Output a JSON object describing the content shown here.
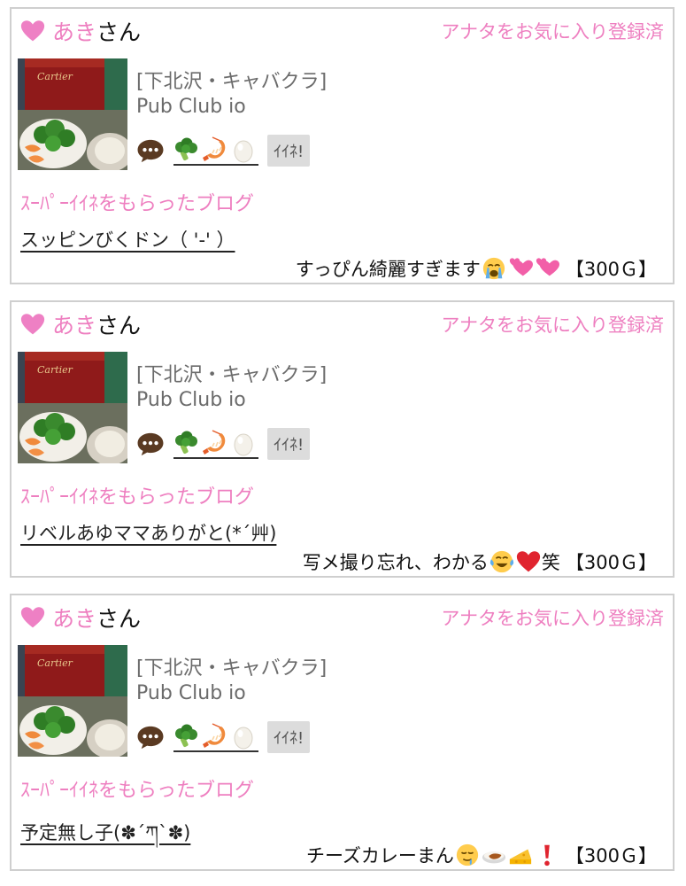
{
  "posts": [
    {
      "user_name": "あき",
      "honorific": "さん",
      "favorite_status": "アナタをお気に入り登録済",
      "shop_category": "[下北沢・キャバクラ]",
      "shop_name": "Pub Club io",
      "iine_label": "ｲｲﾈ!",
      "super_iine_label": "ｽｰﾊﾟｰｲｲﾈをもらったブログ",
      "blog_title": "スッピンびくドン（ '-' ）",
      "comment_text": "すっぴん綺麗すぎます",
      "comment_emojis": [
        "crying-face-icon",
        "two-hearts-icon",
        "two-hearts-icon"
      ],
      "price": "【300Ｇ】"
    },
    {
      "user_name": "あき",
      "honorific": "さん",
      "favorite_status": "アナタをお気に入り登録済",
      "shop_category": "[下北沢・キャバクラ]",
      "shop_name": "Pub Club io",
      "iine_label": "ｲｲﾈ!",
      "super_iine_label": "ｽｰﾊﾟｰｲｲﾈをもらったブログ",
      "blog_title": "リベルあゆママありがと(*´艸)",
      "comment_text": "写メ撮り忘れ、わかる",
      "comment_emojis": [
        "tears-of-joy-icon",
        "red-heart-icon"
      ],
      "comment_text_after": "笑",
      "price": "【300Ｇ】"
    },
    {
      "user_name": "あき",
      "honorific": "さん",
      "favorite_status": "アナタをお気に入り登録済",
      "shop_category": "[下北沢・キャバクラ]",
      "shop_name": "Pub Club io",
      "iine_label": "ｲｲﾈ!",
      "super_iine_label": "ｽｰﾊﾟｰｲｲﾈをもらったブログ",
      "blog_title": "予定無し子(✽´ཀ`✽)",
      "comment_text": "チーズカレーまん",
      "comment_emojis": [
        "drooling-face-icon",
        "curry-rice-icon",
        "cheese-icon",
        "exclamation-icon"
      ],
      "price": "【300Ｇ】"
    }
  ],
  "icons": {
    "user_heart": "heart-icon",
    "comment": "speech-bubble-icon",
    "food_emojis": [
      "broccoli-icon",
      "shrimp-icon",
      "egg-icon"
    ]
  },
  "colors": {
    "accent_pink": "#ee7fc0",
    "muted_text": "#6b6b6b",
    "border": "#cfcfcf",
    "iine_bg": "#dcdcdc"
  }
}
